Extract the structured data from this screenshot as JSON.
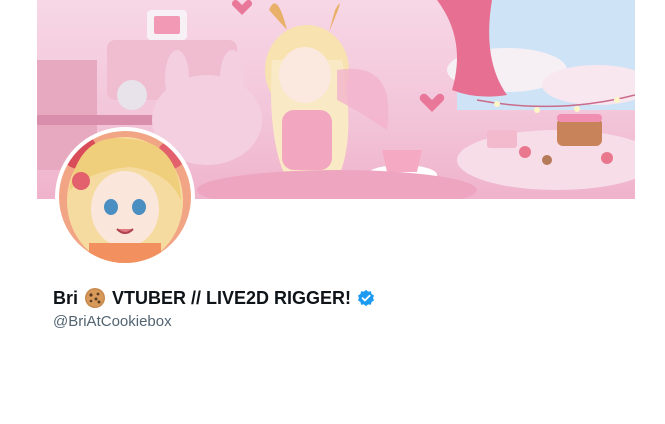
{
  "profile": {
    "name_prefix": "Bri",
    "name_suffix": "VTUBER // LIVE2D RIGGER!",
    "name_emoji": "cookie-emoji",
    "handle": "@BriAtCookiebox",
    "verified": true
  },
  "colors": {
    "banner_pink": "#f3c6da",
    "verified_blue": "#1d9bf0",
    "text_primary": "#0f1419",
    "text_secondary": "#536471"
  }
}
